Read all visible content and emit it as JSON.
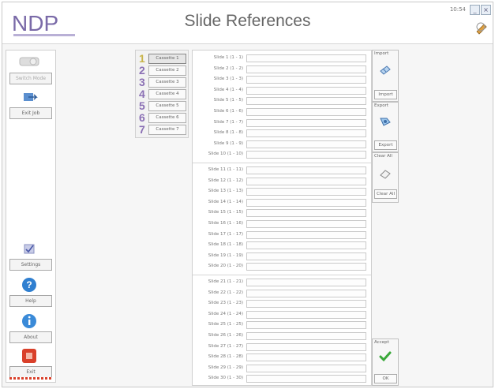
{
  "app": {
    "title": "Slide References",
    "logo_text": "NDP",
    "clock": "10:54"
  },
  "sidebar": {
    "switch_mode_label": "Switch Mode",
    "exit_job_label": "Exit Job",
    "settings_label": "Settings",
    "help_label": "Help",
    "about_label": "About",
    "exit_label": "Exit"
  },
  "cassettes": [
    {
      "num": "1",
      "label": "Cassette 1"
    },
    {
      "num": "2",
      "label": "Cassette 2"
    },
    {
      "num": "3",
      "label": "Cassette 3"
    },
    {
      "num": "4",
      "label": "Cassette 4"
    },
    {
      "num": "5",
      "label": "Cassette 5"
    },
    {
      "num": "6",
      "label": "Cassette 6"
    },
    {
      "num": "7",
      "label": "Cassette 7"
    }
  ],
  "slides": [
    {
      "label": "Slide 1 (1 - 1)",
      "value": ""
    },
    {
      "label": "Slide 2 (1 - 2)",
      "value": ""
    },
    {
      "label": "Slide 3 (1 - 3)",
      "value": ""
    },
    {
      "label": "Slide 4 (1 - 4)",
      "value": ""
    },
    {
      "label": "Slide 5 (1 - 5)",
      "value": ""
    },
    {
      "label": "Slide 6 (1 - 6)",
      "value": ""
    },
    {
      "label": "Slide 7 (1 - 7)",
      "value": ""
    },
    {
      "label": "Slide 8 (1 - 8)",
      "value": ""
    },
    {
      "label": "Slide 9 (1 - 9)",
      "value": ""
    },
    {
      "label": "Slide 10 (1 - 10)",
      "value": ""
    },
    {
      "label": "Slide 11 (1 - 11)",
      "value": ""
    },
    {
      "label": "Slide 12 (1 - 12)",
      "value": ""
    },
    {
      "label": "Slide 13 (1 - 13)",
      "value": ""
    },
    {
      "label": "Slide 14 (1 - 14)",
      "value": ""
    },
    {
      "label": "Slide 15 (1 - 15)",
      "value": ""
    },
    {
      "label": "Slide 16 (1 - 16)",
      "value": ""
    },
    {
      "label": "Slide 17 (1 - 17)",
      "value": ""
    },
    {
      "label": "Slide 18 (1 - 18)",
      "value": ""
    },
    {
      "label": "Slide 19 (1 - 19)",
      "value": ""
    },
    {
      "label": "Slide 20 (1 - 20)",
      "value": ""
    },
    {
      "label": "Slide 21 (1 - 21)",
      "value": ""
    },
    {
      "label": "Slide 22 (1 - 22)",
      "value": ""
    },
    {
      "label": "Slide 23 (1 - 23)",
      "value": ""
    },
    {
      "label": "Slide 24 (1 - 24)",
      "value": ""
    },
    {
      "label": "Slide 25 (1 - 25)",
      "value": ""
    },
    {
      "label": "Slide 26 (1 - 26)",
      "value": ""
    },
    {
      "label": "Slide 27 (1 - 27)",
      "value": ""
    },
    {
      "label": "Slide 28 (1 - 28)",
      "value": ""
    },
    {
      "label": "Slide 29 (1 - 29)",
      "value": ""
    },
    {
      "label": "Slide 30 (1 - 30)",
      "value": ""
    }
  ],
  "actions": {
    "import_title": "Import",
    "import_label": "Import",
    "export_title": "Export",
    "export_label": "Export",
    "clear_title": "Clear All",
    "clear_label": "Clear All",
    "accept_title": "Accept",
    "ok_label": "OK"
  },
  "colors": {
    "accent_purple": "#8a6fb4",
    "ok_green": "#3aa83a",
    "exit_red": "#d9402a",
    "help_blue": "#2f7fd0"
  }
}
